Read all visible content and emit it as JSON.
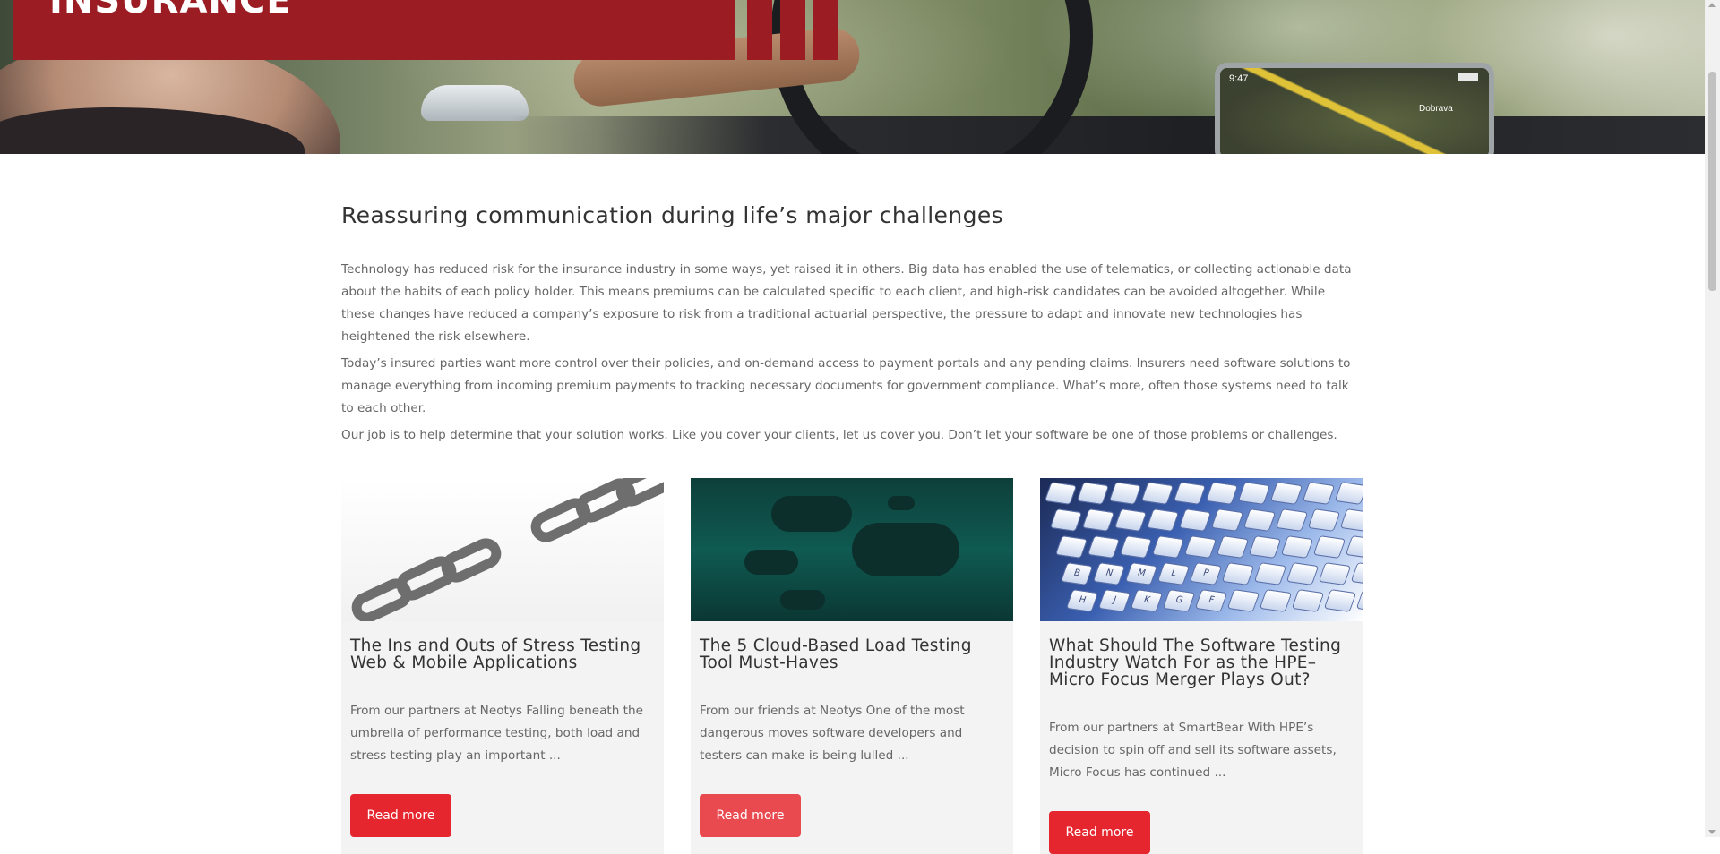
{
  "hero": {
    "title": "INSURANCE",
    "nav_time": "9:47",
    "nav_city": "Dobrava"
  },
  "main": {
    "heading": "Reassuring communication during life’s major challenges",
    "paragraphs": [
      "Technology has reduced risk for the insurance industry in some ways, yet raised it in others.  Big data has enabled the use of telematics, or collecting actionable data about the habits of each policy holder. This means premiums can be calculated specific to each client, and high-risk candidates can be avoided altogether.  While these changes have reduced a company’s exposure to risk from a traditional actuarial perspective, the pressure to adapt and innovate new technologies has heightened the risk elsewhere.",
      "Today’s insured parties want more control over their policies, and on-demand access to payment portals and any pending claims. Insurers need software solutions to manage everything from incoming premium payments to tracking necessary documents for government compliance. What’s more, often those systems need to talk to each other.",
      "Our job is to help determine that your solution works. Like you cover your clients, let us cover you. Don’t let your software be one of those problems or challenges."
    ]
  },
  "cards": [
    {
      "title": "The Ins and Outs of Stress Testing Web & Mobile Applications",
      "excerpt": "From our partners at Neotys Falling beneath the umbrella of performance testing, both load and stress testing play an important ...",
      "button": "Read more",
      "image_icon": "broken-chain-image"
    },
    {
      "title": "The 5 Cloud-Based Load Testing Tool Must-Haves",
      "excerpt": "From our friends at Neotys One of the most dangerous moves software developers and testers can make is being lulled ...",
      "button": "Read more",
      "image_icon": "clouds-image"
    },
    {
      "title": "What Should The Software Testing Industry Watch For as the HPE–Micro Focus Merger Plays Out?",
      "excerpt": "From our partners at SmartBear With HPE’s decision to spin off and sell its software assets, Micro Focus has continued ...",
      "button": "Read more",
      "image_icon": "keyboard-image"
    }
  ],
  "keyboard_keys": [
    "B",
    "N",
    "M",
    "L",
    "P",
    "H",
    "J",
    "K",
    "G",
    "F"
  ],
  "colors": {
    "banner": "#9b1c23",
    "button": "#e5262e",
    "button_hover": "#e94a50",
    "text": "#666666",
    "heading": "#333333",
    "card_bg": "#f3f3f3"
  }
}
